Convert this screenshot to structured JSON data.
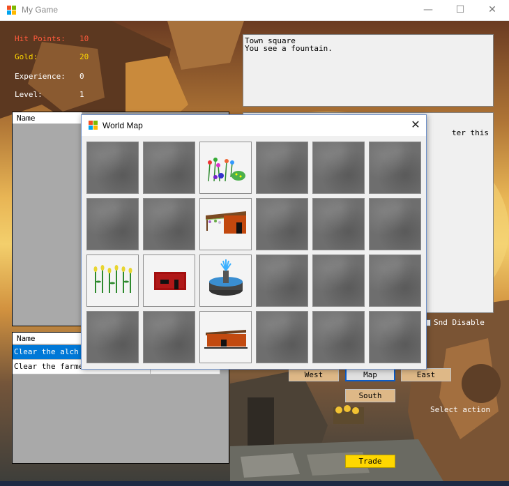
{
  "window": {
    "title": "My Game",
    "minimize_icon": "minimize-icon",
    "maximize_icon": "maximize-icon",
    "close_icon": "close-icon"
  },
  "stats": [
    {
      "label": "Hit Points:",
      "value": "10",
      "color": "#ff5a3c"
    },
    {
      "label": "Gold:",
      "value": "20",
      "color": "#ffd700"
    },
    {
      "label": "Experience:",
      "value": "0",
      "color": "#ffffff"
    },
    {
      "label": "Level:",
      "value": "1",
      "color": "#ffffff"
    }
  ],
  "location": {
    "text": "Town square\nYou see a fountain."
  },
  "messages": {
    "visible_fragment": "ter this"
  },
  "inventory": {
    "columns": [
      "Name"
    ]
  },
  "quests": {
    "columns": [
      "Name",
      ""
    ],
    "rows": [
      {
        "name": "Clear the alch",
        "done": "",
        "selected": true
      },
      {
        "name": "Clear the farmer's field",
        "done": "False",
        "selected": false
      }
    ]
  },
  "sound_toggle": {
    "label": "Snd Disable"
  },
  "navigation": {
    "west": "West",
    "map": "Map",
    "east": "East",
    "south": "South",
    "trade": "Trade"
  },
  "action_label": "Select action",
  "colors": {
    "selection": "#0078d7",
    "button": "#deb887",
    "trade": "#ffd700",
    "map_focus": "#0b5cc8"
  },
  "world_map": {
    "title": "World Map",
    "close_icon": "close-icon",
    "tiles": [
      [
        "fog",
        "fog",
        "flower-garden",
        "fog",
        "fog",
        "fog"
      ],
      [
        "fog",
        "fog",
        "herb-hut",
        "fog",
        "fog",
        "fog"
      ],
      [
        "farm-field",
        "farmhouse",
        "fountain",
        "fog",
        "fog",
        "fog"
      ],
      [
        "fog",
        "fog",
        "bridge-shack",
        "fog",
        "fog",
        "fog"
      ]
    ]
  }
}
